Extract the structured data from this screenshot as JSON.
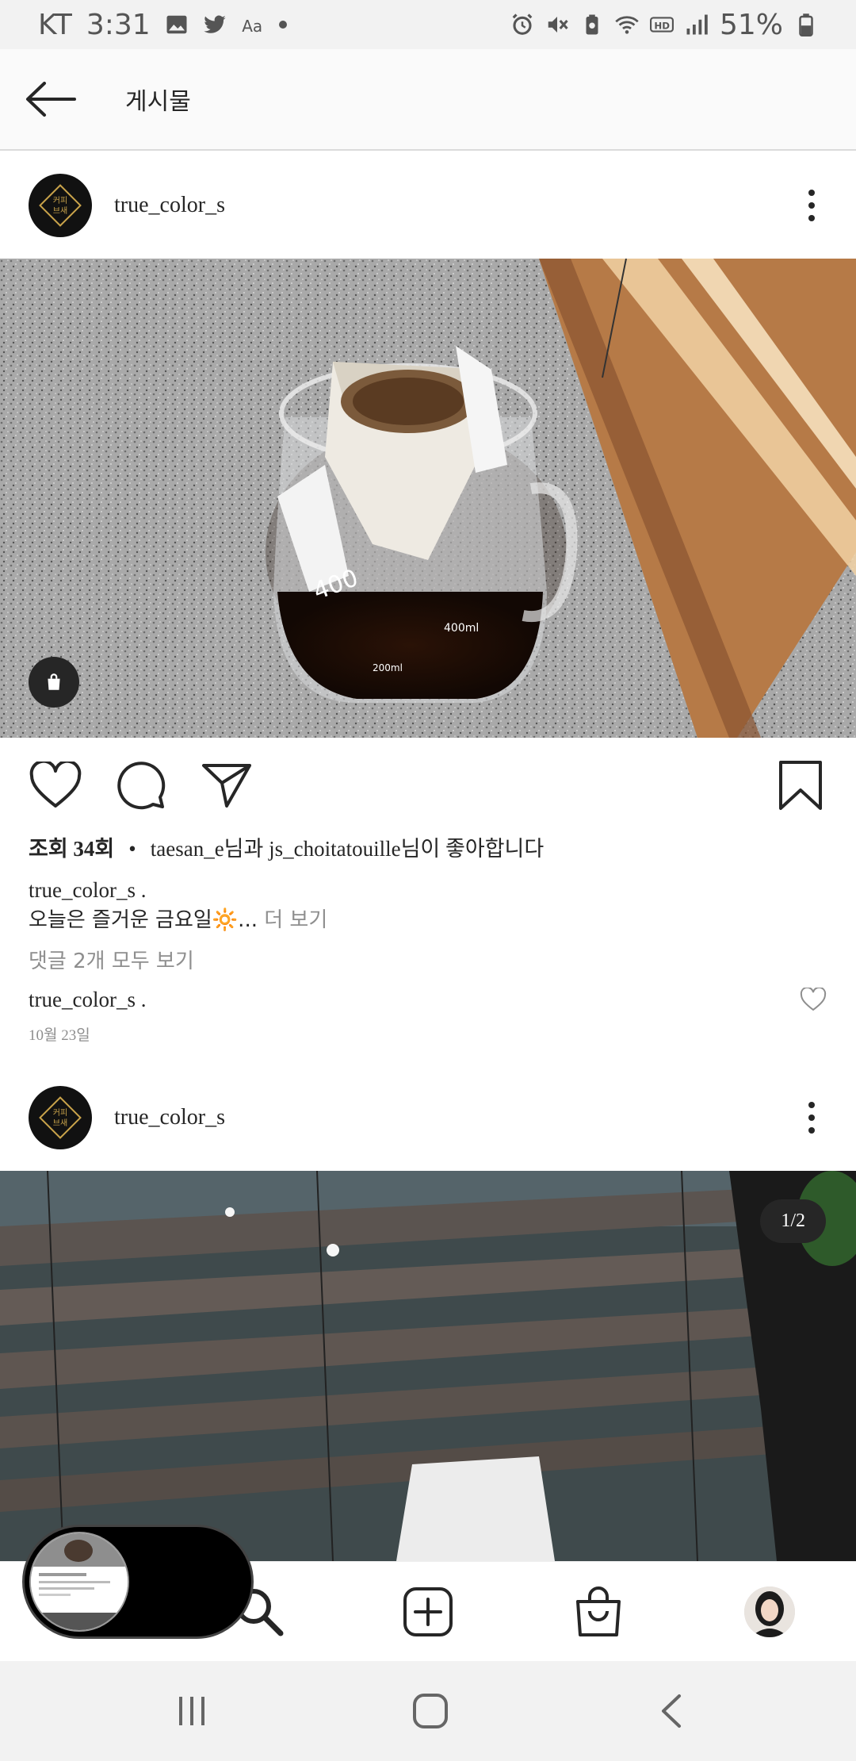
{
  "status_bar": {
    "carrier": "KT",
    "time": "3:31",
    "battery": "51%",
    "left_icons": [
      "gallery-icon",
      "twitter-icon",
      "font-icon",
      "dot-icon"
    ],
    "right_icons": [
      "alarm-icon",
      "mute-icon",
      "battery-saver-icon",
      "wifi-icon",
      "hd-icon",
      "signal-icon",
      "battery-icon"
    ]
  },
  "header": {
    "title": "게시물"
  },
  "post1": {
    "username": "true_color_s",
    "avatar_text": "커피\n브새",
    "views": "조회 34회",
    "separator": "•",
    "liked_by": "taesan_e님과 js_choitatouille님이 좋아합니다",
    "caption_user": "true_color_s .",
    "caption_text": "오늘은 즐거운 금요일🔆...",
    "more_label": "더 보기",
    "view_comments": "댓글 2개 모두 보기",
    "comment_user": "true_color_s .",
    "date": "10월 23일"
  },
  "post2": {
    "username": "true_color_s",
    "avatar_text": "커피\n브새",
    "page_indicator": "1/2"
  },
  "colors": {
    "text": "#262626",
    "secondary": "#8e8e8e",
    "divider": "#dbdbdb",
    "status_bg": "#f2f2f2"
  }
}
